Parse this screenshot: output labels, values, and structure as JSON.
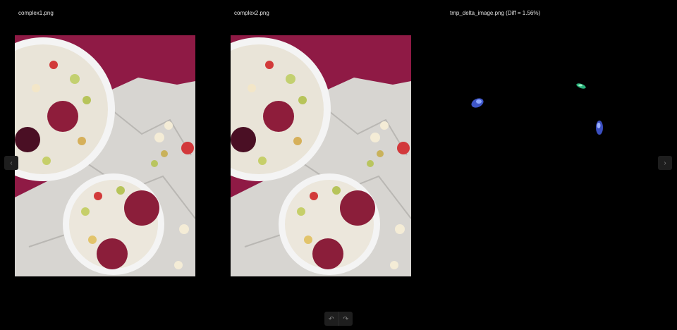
{
  "panels": [
    {
      "title": "complex1.png"
    },
    {
      "title": "complex2.png"
    },
    {
      "title": "tmp_delta_image.png (Diff = 1.56%)"
    }
  ],
  "icons": {
    "prev": "chevron-left-icon",
    "next": "chevron-right-icon",
    "rotate_left": "rotate-left-icon",
    "rotate_right": "rotate-right-icon"
  },
  "colors": {
    "background": "#000000",
    "button_bg": "#1e1e1e",
    "cloth": "#8f1a45",
    "paper": "#d8d6d2"
  }
}
